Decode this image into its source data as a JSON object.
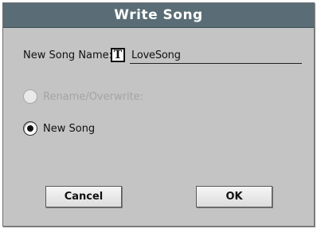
{
  "dialog": {
    "title": "Write Song",
    "name_label": "New Song Name:",
    "text_icon_glyph": "T",
    "song_name": "LoveSong",
    "options": [
      {
        "label": "Rename/Overwrite:",
        "state": "disabled"
      },
      {
        "label": "New Song",
        "state": "selected"
      }
    ],
    "buttons": {
      "cancel": "Cancel",
      "ok": "OK"
    }
  },
  "colors": {
    "title_bar": "#5a6d76",
    "dialog_bg": "#c4c4c4",
    "disabled_text": "#a4a4a4"
  },
  "icons": {
    "text_edit": "text-edit-icon"
  }
}
